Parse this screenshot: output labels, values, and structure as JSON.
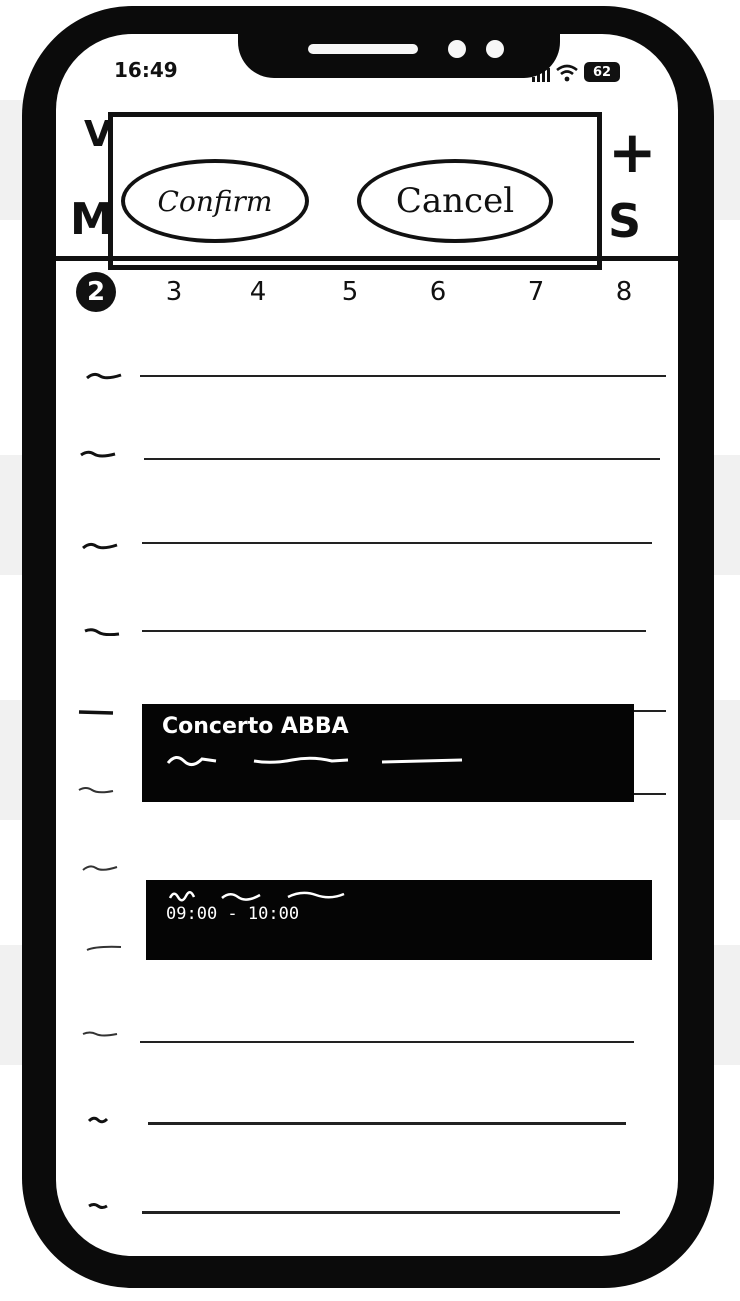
{
  "status_bar": {
    "time": "16:49",
    "signal_icon": "signal-bars-icon",
    "wifi_icon": "wifi-icon",
    "battery_level": "62"
  },
  "header": {
    "partial_left_top": "V",
    "partial_left_bottom": "M",
    "add_label": "+",
    "partial_right_bottom": "S"
  },
  "dialog": {
    "confirm_label": "Confirm",
    "cancel_label": "Cancel"
  },
  "week": {
    "days": [
      "2",
      "3",
      "4",
      "5",
      "6",
      "7",
      "8"
    ],
    "selected": "2"
  },
  "events": [
    {
      "title": "Concerto ABBA",
      "time": ""
    },
    {
      "title": "",
      "time": "09:00 - 10:00"
    }
  ],
  "colors": {
    "ink": "#111111",
    "background": "#ffffff",
    "event_fill": "#050505"
  }
}
